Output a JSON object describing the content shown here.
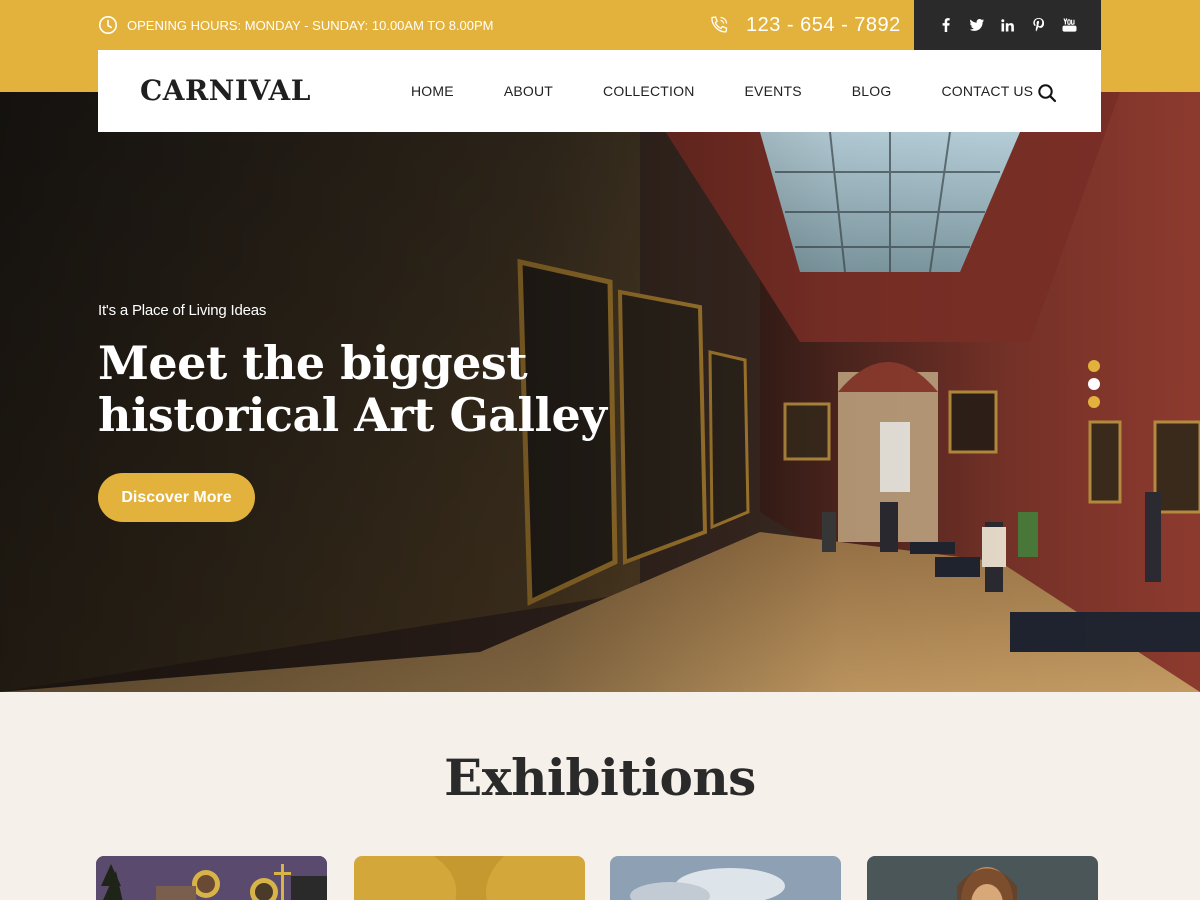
{
  "topbar": {
    "hours": "OPENING HOURS: MONDAY - SUNDAY: 10.00AM TO 8.00PM",
    "hours_icon": "clock-icon",
    "phone": "123 - 654 - 7892",
    "phone_icon": "phone-icon",
    "social": [
      "facebook-icon",
      "twitter-icon",
      "linkedin-icon",
      "pinterest-icon",
      "youtube-icon"
    ]
  },
  "nav": {
    "logo": "CARNIVAL",
    "items": [
      "HOME",
      "ABOUT",
      "COLLECTION",
      "EVENTS",
      "BLOG",
      "CONTACT US"
    ],
    "search_icon": "search-icon"
  },
  "hero": {
    "tagline": "It's a Place of Living Ideas",
    "headline": "Meet the biggest historical Art Galley",
    "cta": "Discover More",
    "slides": 3,
    "active_slide": 2
  },
  "exhibitions": {
    "title": "Exhibitions"
  },
  "colors": {
    "accent": "#e3b23c",
    "dark": "#2a2a2a",
    "background": "#f6f0ea"
  }
}
